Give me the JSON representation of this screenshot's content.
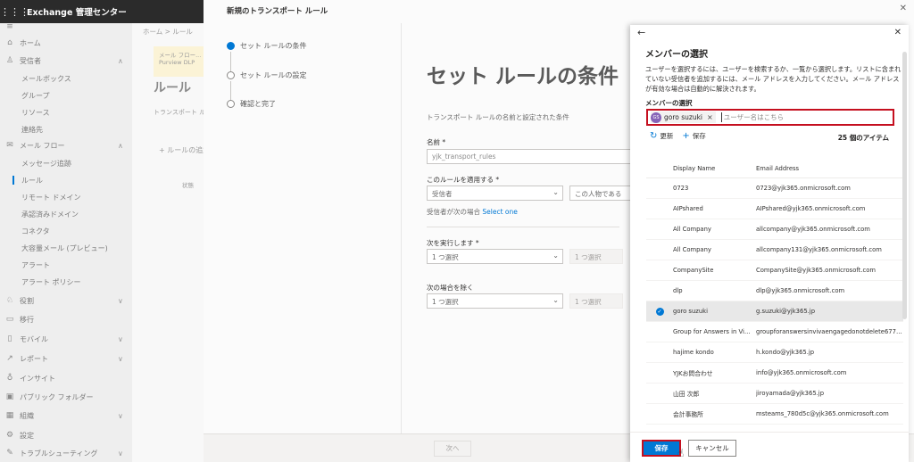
{
  "app": {
    "title": "Exchange 管理センター"
  },
  "nav": [
    {
      "icon": "≡",
      "label": "",
      "chev": ""
    },
    {
      "icon": "⌂",
      "label": "ホーム",
      "chev": ""
    },
    {
      "icon": "♙",
      "label": "受信者",
      "chev": "∧"
    },
    {
      "icon": "",
      "label": "メールボックス",
      "chev": "",
      "sub": true
    },
    {
      "icon": "",
      "label": "グループ",
      "chev": "",
      "sub": true
    },
    {
      "icon": "",
      "label": "リソース",
      "chev": "",
      "sub": true
    },
    {
      "icon": "",
      "label": "連絡先",
      "chev": "",
      "sub": true
    },
    {
      "icon": "✉",
      "label": "メール フロー",
      "chev": "∧"
    },
    {
      "icon": "",
      "label": "メッセージ追跡",
      "chev": "",
      "sub": true
    },
    {
      "icon": "",
      "label": "ルール",
      "chev": "",
      "sub": true,
      "active": true
    },
    {
      "icon": "",
      "label": "リモート ドメイン",
      "chev": "",
      "sub": true
    },
    {
      "icon": "",
      "label": "承認済みドメイン",
      "chev": "",
      "sub": true
    },
    {
      "icon": "",
      "label": "コネクタ",
      "chev": "",
      "sub": true
    },
    {
      "icon": "",
      "label": "大容量メール (プレビュー)",
      "chev": "",
      "sub": true
    },
    {
      "icon": "",
      "label": "アラート",
      "chev": "",
      "sub": true
    },
    {
      "icon": "",
      "label": "アラート ポリシー",
      "chev": "",
      "sub": true
    },
    {
      "icon": "♘",
      "label": "役割",
      "chev": "∨"
    },
    {
      "icon": "▭",
      "label": "移行",
      "chev": ""
    },
    {
      "icon": "▯",
      "label": "モバイル",
      "chev": "∨"
    },
    {
      "icon": "↗",
      "label": "レポート",
      "chev": "∨"
    },
    {
      "icon": "♁",
      "label": "インサイト",
      "chev": ""
    },
    {
      "icon": "▣",
      "label": "パブリック フォルダー",
      "chev": ""
    },
    {
      "icon": "▦",
      "label": "組織",
      "chev": "∨"
    },
    {
      "icon": "⚙",
      "label": "設定",
      "chev": ""
    },
    {
      "icon": "✎",
      "label": "トラブルシューティング",
      "chev": "∨"
    }
  ],
  "bg": {
    "breadcrumb": "ホーム > ルール",
    "notice_line1": "メール フロー...",
    "notice_line2": "Purview DLP",
    "heading": "ルール",
    "subtitle": "トランスポート ルール...",
    "add_rule": "+ ルールの追加",
    "status_col": "状態"
  },
  "wizard": {
    "title": "新規のトランスポート ルール",
    "steps": [
      "セット ルールの条件",
      "セット ルールの設定",
      "確認と完了"
    ],
    "heading": "セット ルールの条件",
    "description": "トランスポート ルールの名前と設定された条件",
    "name_label": "名前 *",
    "name_value": "yjk_transport_rules",
    "apply_label": "このルールを適用する *",
    "apply_select1": "受信者",
    "apply_select2": "この人物である",
    "condition_text": "受信者が次の場合",
    "condition_link": "Select one",
    "do_label": "次を実行します *",
    "do_select1": "1 つ選択",
    "do_select2": "1 つ選択",
    "except_label": "次の場合を除く",
    "except_select1": "1 つ選択",
    "except_select2": "1 つ選択",
    "next_button": "次へ"
  },
  "flyout": {
    "title": "メンバーの選択",
    "description": "ユーザーを選択するには、ユーザーを検索するか、一覧から選択します。リストに含まれていない受信者を追加するには、メール アドレスを入力してください。メール アドレスが有効な場合は自動的に解決されます。",
    "select_label": "メンバーの選択",
    "chip_initials": "GS",
    "chip_name": "goro suzuki",
    "placeholder": "ユーザー名はこちら",
    "refresh": "更新",
    "save_tb": "保存",
    "item_count": "25 個のアイテム",
    "col_name": "Display Name",
    "col_mail": "Email Address",
    "rows": [
      {
        "name": "0723",
        "mail": "0723@yjk365.onmicrosoft.com",
        "selected": false
      },
      {
        "name": "AIPshared",
        "mail": "AIPshared@yjk365.onmicrosoft.com",
        "selected": false
      },
      {
        "name": "All Company",
        "mail": "allcompany@yjk365.onmicrosoft.com",
        "selected": false
      },
      {
        "name": "All Company",
        "mail": "allcompany131@yjk365.onmicrosoft.com",
        "selected": false
      },
      {
        "name": "CompanySite",
        "mail": "CompanySite@yjk365.onmicrosoft.com",
        "selected": false
      },
      {
        "name": "dlp",
        "mail": "dlp@yjk365.onmicrosoft.com",
        "selected": false
      },
      {
        "name": "goro suzuki",
        "mail": "g.suzuki@yjk365.jp",
        "selected": true
      },
      {
        "name": "Group for Answers in Viva ...",
        "mail": "groupforanswersinvivaengagedonotdelete6775274700...",
        "selected": false
      },
      {
        "name": "hajime kondo",
        "mail": "h.kondo@yjk365.jp",
        "selected": false
      },
      {
        "name": "YJKお問合わせ",
        "mail": "info@yjk365.onmicrosoft.com",
        "selected": false
      },
      {
        "name": "山田 次郎",
        "mail": "jiroyamada@yjk365.jp",
        "selected": false
      },
      {
        "name": "会計事務所",
        "mail": "msteams_780d5c@yjk365.onmicrosoft.com",
        "selected": false
      }
    ],
    "save_button": "保存",
    "cancel_button": "キャンセル"
  }
}
